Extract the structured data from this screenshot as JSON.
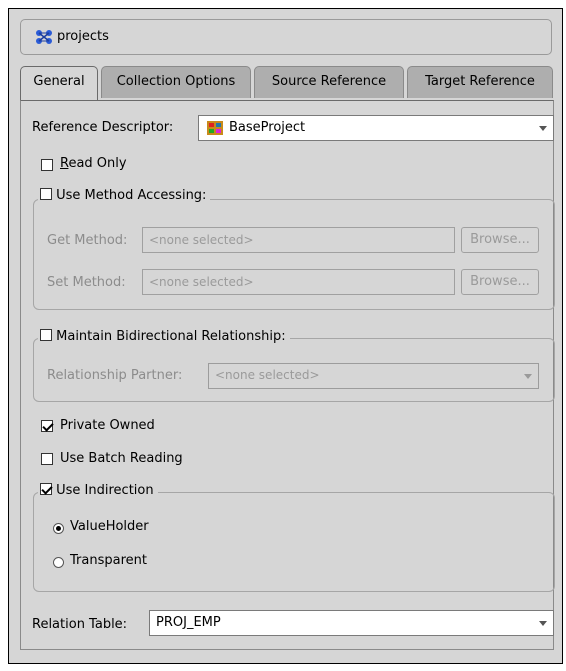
{
  "header": {
    "title": "projects",
    "icon": "mapping-icon"
  },
  "tabs": [
    {
      "label": "General",
      "active": true
    },
    {
      "label": "Collection Options",
      "active": false
    },
    {
      "label": "Source Reference",
      "active": false
    },
    {
      "label": "Target Reference",
      "active": false
    }
  ],
  "general": {
    "reference_descriptor": {
      "label": "Reference Descriptor:",
      "value": "BaseProject",
      "icon": "descriptor-icon"
    },
    "read_only": {
      "label": "Read Only",
      "checked": false
    },
    "method_accessing": {
      "label": "Use Method Accessing:",
      "checked": false,
      "get_label": "Get Method:",
      "get_value": "<none selected>",
      "set_label": "Set Method:",
      "set_value": "<none selected>",
      "browse_label": "Browse..."
    },
    "bidirectional": {
      "label": "Maintain Bidirectional Relationship:",
      "checked": false,
      "partner_label": "Relationship Partner:",
      "partner_value": "<none selected>"
    },
    "private_owned": {
      "label": "Private Owned",
      "checked": true
    },
    "batch_reading": {
      "label": "Use Batch Reading",
      "checked": false
    },
    "indirection": {
      "label": "Use Indirection",
      "checked": true,
      "valueholder_label": "ValueHolder",
      "transparent_label": "Transparent",
      "selected": "ValueHolder"
    },
    "relation_table": {
      "label": "Relation Table:",
      "value": "PROJ_EMP"
    }
  }
}
